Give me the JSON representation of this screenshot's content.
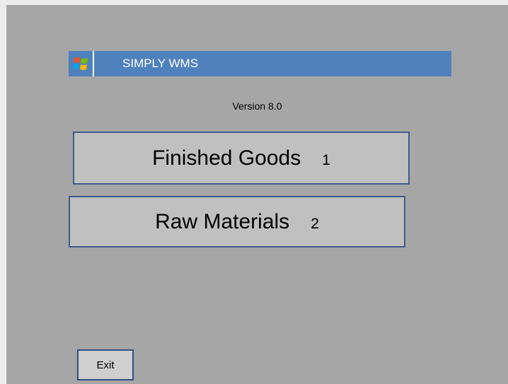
{
  "app": {
    "title": "SIMPLY WMS",
    "version": "Version 8.0",
    "logo_icon": "windows-flag-icon"
  },
  "menu": {
    "items": [
      {
        "label": "Finished Goods",
        "key": "1"
      },
      {
        "label": "Raw Materials",
        "key": "2"
      }
    ]
  },
  "footer": {
    "exit_label": "Exit"
  },
  "colors": {
    "background": "#a6a6a6",
    "titlebar": "#4f81bd",
    "button": "#c0c0c0",
    "button_border": "#3f5a8a"
  }
}
